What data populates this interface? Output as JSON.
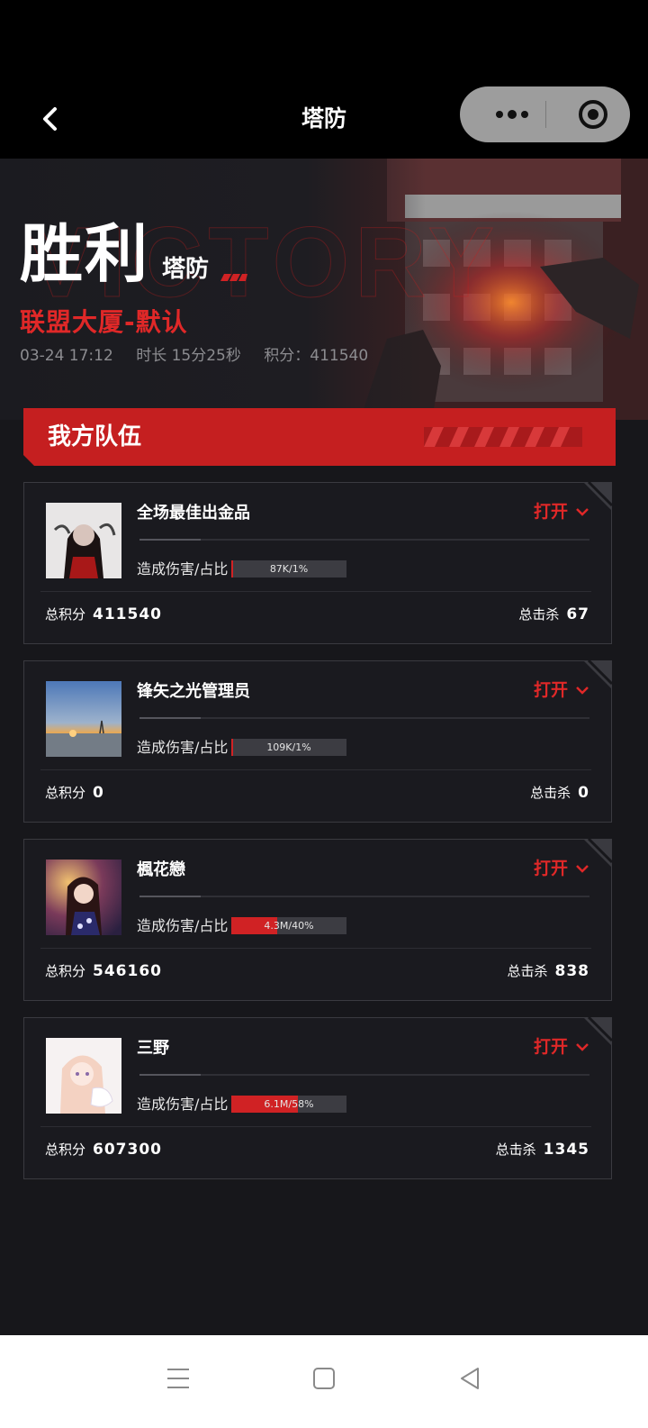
{
  "nav": {
    "title": "塔防",
    "icons": {
      "back": "chevron-left-icon",
      "more": "more-dots-icon",
      "close": "target-icon"
    }
  },
  "hero": {
    "result": "胜利",
    "mode": "塔防",
    "map": "联盟大厦-默认",
    "date": "03-24 17:12",
    "duration": "时长 15分25秒",
    "score": "积分：411540"
  },
  "team": {
    "title": "我方队伍"
  },
  "labels": {
    "damage": "造成伤害/占比",
    "total_score": "总积分",
    "total_kills": "总击杀",
    "open": "打开"
  },
  "players": [
    {
      "name": "全场最佳出金品",
      "damage_text": "87K/1%",
      "damage_fraction": 0.01,
      "total_score": "411540",
      "total_kills": "67"
    },
    {
      "name": "锋矢之光管理员",
      "damage_text": "109K/1%",
      "damage_fraction": 0.01,
      "total_score": "0",
      "total_kills": "0"
    },
    {
      "name": "楓花戀",
      "damage_text": "4.3M/40%",
      "damage_fraction": 0.4,
      "total_score": "546160",
      "total_kills": "838"
    },
    {
      "name": "三野",
      "damage_text": "6.1M/58%",
      "damage_fraction": 0.58,
      "total_score": "607300",
      "total_kills": "1345"
    }
  ],
  "colors": {
    "accent": "#c51f20",
    "accent_text": "#e02828",
    "background": "#17171b",
    "card_border": "#3a3a40"
  },
  "system_nav": {
    "icons": [
      "menu-icon",
      "home-square-icon",
      "back-triangle-icon"
    ]
  }
}
